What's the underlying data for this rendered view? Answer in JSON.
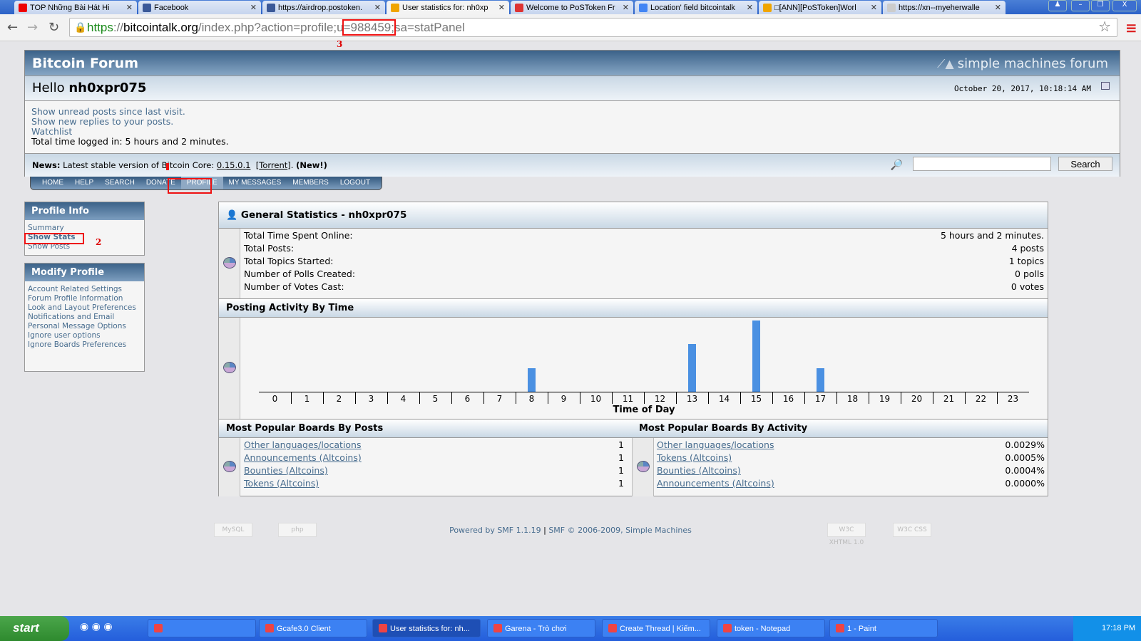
{
  "browser": {
    "tabs": [
      {
        "title": "TOP Những Bài Hát Hi",
        "color": "#e00"
      },
      {
        "title": "Facebook",
        "color": "#3b5998"
      },
      {
        "title": "https://airdrop.postoken.",
        "color": "#3b5998"
      },
      {
        "title": "User statistics for: nh0xp",
        "color": "#f0a500"
      },
      {
        "title": "Welcome to PoSToken Fr",
        "color": "#d33"
      },
      {
        "title": "Location' field bitcointalk",
        "color": "#4285f4"
      },
      {
        "title": "□[ANN][PoSToken]Worl",
        "color": "#f0a500"
      },
      {
        "title": "https://xn--myeherwalle",
        "color": "#ccc"
      }
    ],
    "url_scheme": "https",
    "url_sep": "://",
    "url_domain": "bitcointalk.org",
    "url_path": "/index.php?action=profile;u",
    "url_highlight": "=988459;",
    "url_rest": "sa=statPanel",
    "annotations": [
      "1",
      "2",
      "3"
    ]
  },
  "forum": {
    "title": "Bitcoin Forum",
    "logo_text": "simple machines forum",
    "hello": "Hello",
    "username": "nh0xpr075",
    "datetime": "October 20, 2017, 10:18:14 AM",
    "links": [
      "Show unread posts since last visit.",
      "Show new replies to your posts.",
      "Watchlist"
    ],
    "time_logged": "Total time logged in: 5 hours and 2 minutes.",
    "news_label": "News:",
    "news_text": "Latest stable version of Bitcoin Core: ",
    "news_version": "0.15.0.1",
    "news_torrent": "Torrent",
    "news_new": "(New!)",
    "search_value": "",
    "search_button": "Search",
    "menu": [
      "HOME",
      "HELP",
      "SEARCH",
      "DONATE",
      "PROFILE",
      "MY MESSAGES",
      "MEMBERS",
      "LOGOUT"
    ]
  },
  "sidebar": {
    "profile_info": {
      "title": "Profile Info",
      "items": [
        "Summary",
        "Show Stats",
        "Show Posts"
      ]
    },
    "modify_profile": {
      "title": "Modify Profile",
      "items": [
        "Account Related Settings",
        "Forum Profile Information",
        "Look and Layout Preferences",
        "Notifications and Email",
        "Personal Message Options",
        "Ignore user options",
        "Ignore Boards Preferences"
      ]
    }
  },
  "stats": {
    "title": "General Statistics - nh0xpr075",
    "rows": [
      {
        "label": "Total Time Spent Online:",
        "value": "5 hours and 2 minutes."
      },
      {
        "label": "Total Posts:",
        "value": "4 posts"
      },
      {
        "label": "Total Topics Started:",
        "value": "1 topics"
      },
      {
        "label": "Number of Polls Created:",
        "value": "0 polls"
      },
      {
        "label": "Number of Votes Cast:",
        "value": "0 votes"
      }
    ],
    "activity_title": "Posting Activity By Time",
    "boards_posts_title": "Most Popular Boards By Posts",
    "boards_posts": [
      {
        "name": "Other languages/locations",
        "value": "1"
      },
      {
        "name": "Announcements (Altcoins)",
        "value": "1"
      },
      {
        "name": "Bounties (Altcoins)",
        "value": "1"
      },
      {
        "name": "Tokens (Altcoins)",
        "value": "1"
      }
    ],
    "boards_activity_title": "Most Popular Boards By Activity",
    "boards_activity": [
      {
        "name": "Other languages/locations",
        "value": "0.0029%"
      },
      {
        "name": "Tokens (Altcoins)",
        "value": "0.0005%"
      },
      {
        "name": "Bounties (Altcoins)",
        "value": "0.0004%"
      },
      {
        "name": "Announcements (Altcoins)",
        "value": "0.0000%"
      }
    ]
  },
  "chart_data": {
    "type": "bar",
    "title": "Posting Activity By Time",
    "xlabel": "Time of Day",
    "ylabel": "",
    "categories": [
      "0",
      "1",
      "2",
      "3",
      "4",
      "5",
      "6",
      "7",
      "8",
      "9",
      "10",
      "11",
      "12",
      "13",
      "14",
      "15",
      "16",
      "17",
      "18",
      "19",
      "20",
      "21",
      "22",
      "23"
    ],
    "values": [
      0,
      0,
      0,
      0,
      0,
      0,
      0,
      0,
      1,
      0,
      0,
      0,
      0,
      2,
      0,
      3,
      0,
      1,
      0,
      0,
      0,
      0,
      0,
      0
    ],
    "ylim": [
      0,
      3
    ],
    "color": "#4a90e2"
  },
  "footer": {
    "powered": "Powered by SMF 1.1.19",
    "sep": " | ",
    "copyright": "SMF © 2006-2009, Simple Machines",
    "badges": [
      "MySQL",
      "php",
      "W3C XHTML 1.0",
      "W3C CSS"
    ]
  },
  "taskbar": {
    "start": "start",
    "tasks": [
      "",
      "Gcafe3.0 Client",
      "User statistics for: nh...",
      "Garena - Trò chơi",
      "Create Thread | Kiếm...",
      "token - Notepad",
      "1 - Paint"
    ],
    "clock": "17:18 PM"
  }
}
